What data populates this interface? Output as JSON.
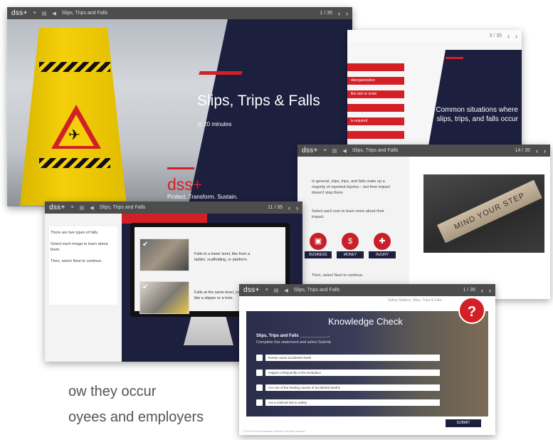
{
  "background_text": {
    "line1": "ow they occur",
    "line2": "oyees and employers"
  },
  "slide1": {
    "logo": "dss+",
    "course": "Slips, Trips and Falls",
    "page": "1 / 35",
    "title": "Slips, Trips & Falls",
    "duration": "20 minutes",
    "brand": "dss+",
    "tagline": "Protect. Transform. Sustain."
  },
  "slide2": {
    "page": "3 / 35",
    "items": [
      "disorganization",
      "like rain or snow",
      "",
      "is required",
      ""
    ],
    "title": "Common situations where slips, trips, and falls occur"
  },
  "slide3": {
    "logo": "dss+",
    "course": "Slips, Trips and Falls",
    "page": "14 / 35",
    "intro": "In general, slips, trips, and falls make up a majority of reported injuries – but their impact doesn't stop there.",
    "instruction": "Select each icon to learn more about their impact.",
    "next": "Then, select Next to continue.",
    "icons": [
      {
        "label": "BUSINESS",
        "icon": "briefcase-icon"
      },
      {
        "label": "MONEY",
        "icon": "money-bag-icon"
      },
      {
        "label": "INJURY",
        "icon": "injury-icon"
      }
    ],
    "sign_text": "MIND YOUR STEP"
  },
  "slide4": {
    "logo": "dss+",
    "course": "Slips, Trips and Falls",
    "page": "11 / 35",
    "intro": "There are two types of falls.",
    "instruction": "Select each image to learn about them.",
    "next": "Then, select Next to continue.",
    "fall1": "Falls to a lower level, like from a ladder, scaffolding, or platform.",
    "fall2": "Falls at the same level, condition like a slipper or a hole."
  },
  "slide5": {
    "logo": "dss+",
    "course": "Slips, Trips and Falls",
    "page": "1 / 35",
    "breadcrumb": "Safety Matters: Slips, Trips & Falls",
    "heading": "Knowledge Check",
    "question_title": "Slips, Trips and Falls ____________.",
    "question_sub": "Complete this statement and select Submit.",
    "options": [
      "Rarely cause accidental death",
      "Happen infrequently in the workplace",
      "Are one of the leading causes of accidental deaths",
      "Are a minimal risk to safety"
    ],
    "submit": "SUBMIT",
    "footer": "© 2023 DuPont Sustainable Solutions. All rights reserved."
  }
}
